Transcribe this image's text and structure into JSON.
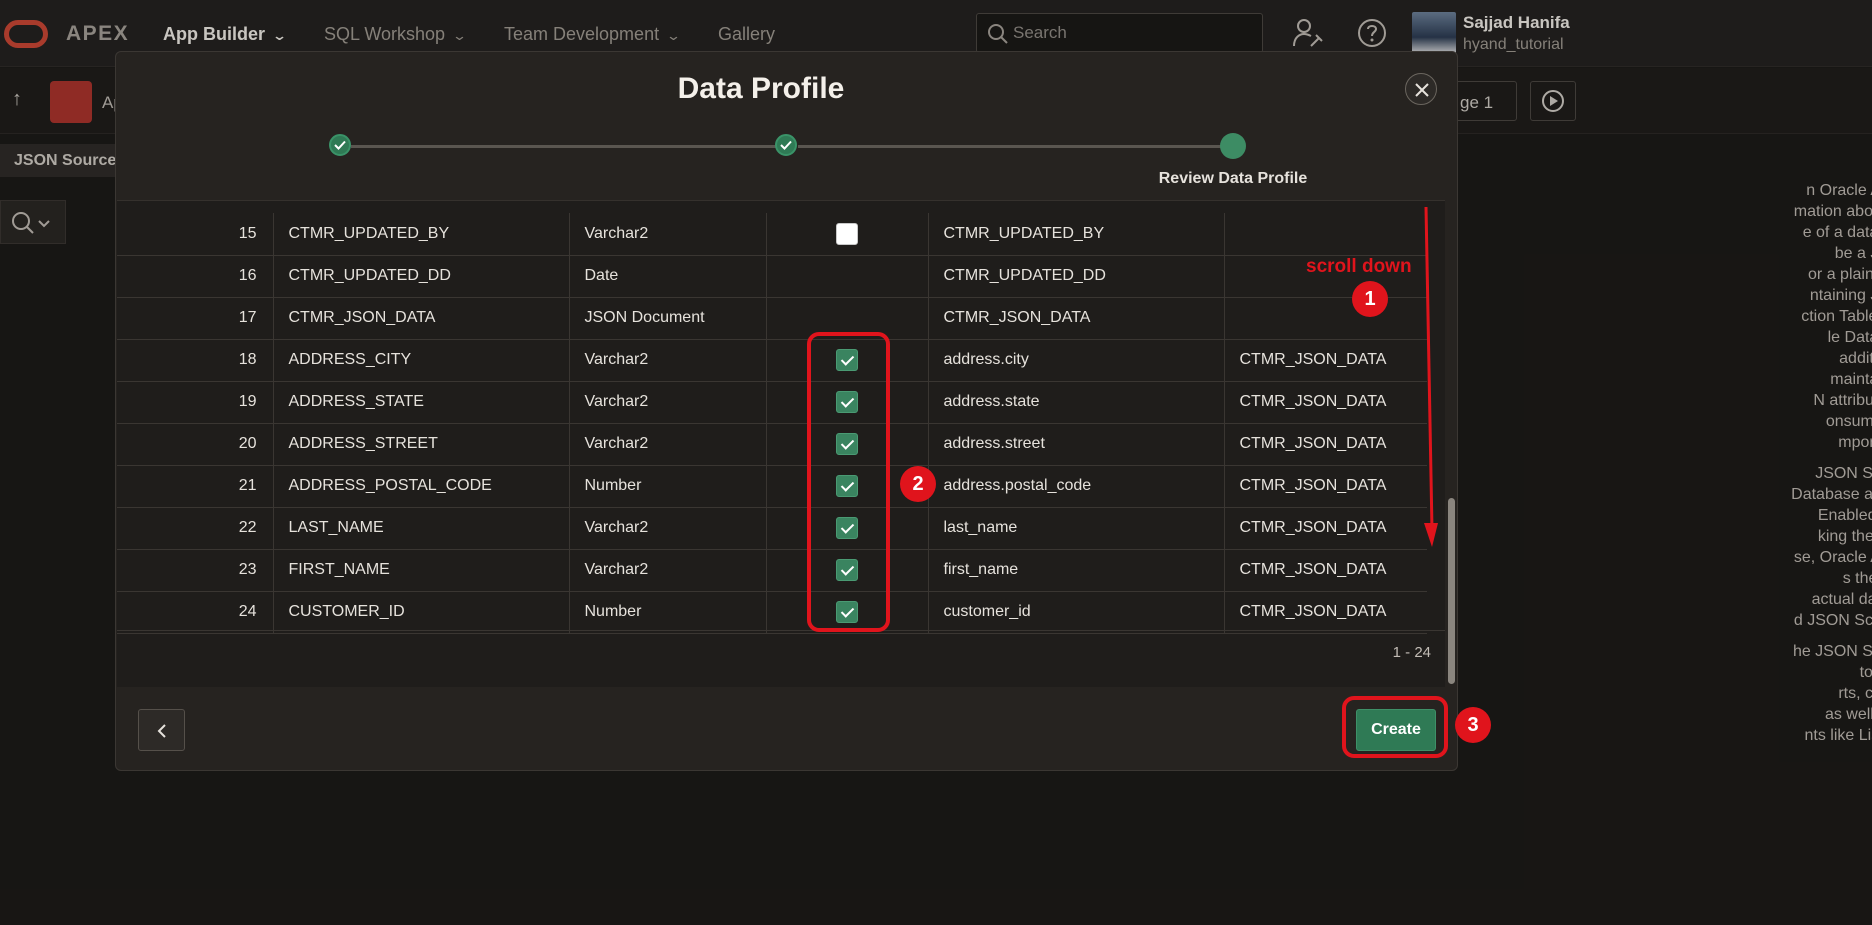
{
  "topnav": {
    "brand": "APEX",
    "items": [
      {
        "label": "App Builder",
        "chevron": true
      },
      {
        "label": "SQL Workshop",
        "chevron": true
      },
      {
        "label": "Team Development",
        "chevron": true
      },
      {
        "label": "Gallery",
        "chevron": false
      }
    ],
    "search_placeholder": "Search",
    "user_name": "Sajjad Hanifa",
    "workspace": "hyand_tutorial"
  },
  "background": {
    "app_label_partial": "Ap",
    "page_button_partial": "ge 1",
    "json_sources_tab": "JSON Sources",
    "help_paragraphs": [
      [
        "n Oracle APEX",
        "mation about the",
        "e of a database",
        "be a JSON",
        "or a plain table",
        "ntaining JSON",
        "ction Tables are",
        "le Database",
        "addition, a",
        "maintained,",
        "N attributes to",
        "onsumed by",
        "mponents."
      ],
      [
        "JSON Source",
        "Database as well",
        "Enabled SQL",
        "king the table",
        "se, Oracle APEX",
        "s the data",
        "actual data, or",
        "d JSON Schema"
      ],
      [
        "he JSON Source",
        "to page",
        "rts, charts,",
        "as well as to",
        "nts like Lists Of"
      ]
    ]
  },
  "modal": {
    "title": "Data Profile",
    "current_step_label": "Review Data Profile",
    "rows": [
      {
        "num": "15",
        "column": "CTMR_UPDATED_BY",
        "type": "Varchar2",
        "checkbox": "unchecked",
        "path": "CTMR_UPDATED_BY",
        "source": ""
      },
      {
        "num": "16",
        "column": "CTMR_UPDATED_DD",
        "type": "Date",
        "checkbox": "none",
        "path": "CTMR_UPDATED_DD",
        "source": ""
      },
      {
        "num": "17",
        "column": "CTMR_JSON_DATA",
        "type": "JSON Document",
        "checkbox": "none",
        "path": "CTMR_JSON_DATA",
        "source": ""
      },
      {
        "num": "18",
        "column": "ADDRESS_CITY",
        "type": "Varchar2",
        "checkbox": "checked",
        "path": "address.city",
        "source": "CTMR_JSON_DATA"
      },
      {
        "num": "19",
        "column": "ADDRESS_STATE",
        "type": "Varchar2",
        "checkbox": "checked",
        "path": "address.state",
        "source": "CTMR_JSON_DATA"
      },
      {
        "num": "20",
        "column": "ADDRESS_STREET",
        "type": "Varchar2",
        "checkbox": "checked",
        "path": "address.street",
        "source": "CTMR_JSON_DATA"
      },
      {
        "num": "21",
        "column": "ADDRESS_POSTAL_CODE",
        "type": "Number",
        "checkbox": "checked",
        "path": "address.postal_code",
        "source": "CTMR_JSON_DATA"
      },
      {
        "num": "22",
        "column": "LAST_NAME",
        "type": "Varchar2",
        "checkbox": "checked",
        "path": "last_name",
        "source": "CTMR_JSON_DATA"
      },
      {
        "num": "23",
        "column": "FIRST_NAME",
        "type": "Varchar2",
        "checkbox": "checked",
        "path": "first_name",
        "source": "CTMR_JSON_DATA"
      },
      {
        "num": "24",
        "column": "CUSTOMER_ID",
        "type": "Number",
        "checkbox": "checked",
        "path": "customer_id",
        "source": "CTMR_JSON_DATA"
      }
    ],
    "pagination": "1 - 24",
    "create_label": "Create"
  },
  "annotations": {
    "scroll_hint": "scroll down",
    "badge_1": "1",
    "badge_2": "2",
    "badge_3": "3"
  },
  "colors": {
    "accent_green": "#2f7a55",
    "annotation_red": "#e0141c",
    "oracle_red": "#c74634"
  }
}
